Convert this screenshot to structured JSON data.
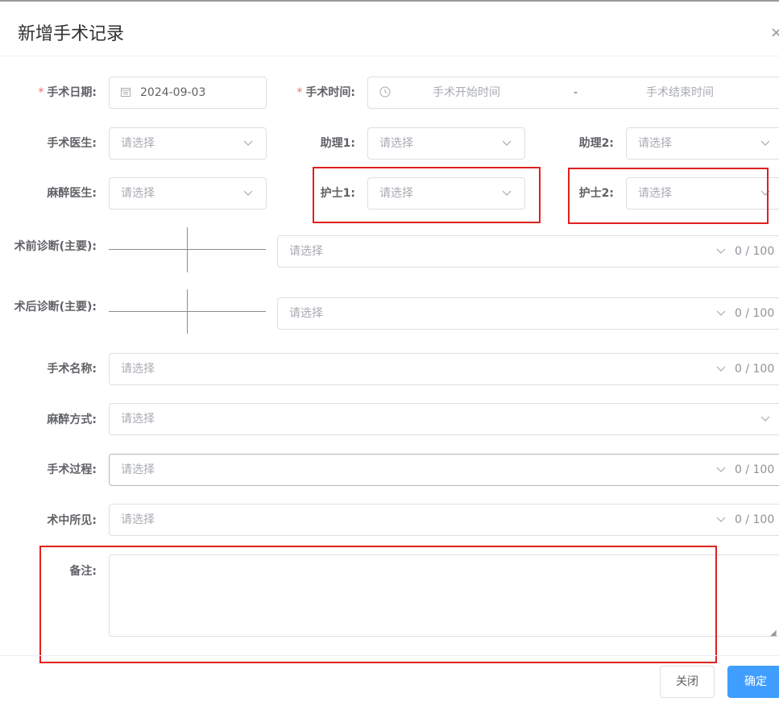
{
  "dialog": {
    "title": "新增手术记录",
    "close_icon": "×"
  },
  "form": {
    "surgery_date": {
      "label": "手术日期:",
      "required_mark": "*",
      "value": "2024-09-03"
    },
    "surgery_time": {
      "label": "手术时间:",
      "required_mark": "*",
      "start_placeholder": "手术开始时间",
      "separator": "-",
      "end_placeholder": "手术结束时间"
    },
    "surgeon": {
      "label": "手术医生:",
      "placeholder": "请选择"
    },
    "assistant1": {
      "label": "助理1:",
      "placeholder": "请选择"
    },
    "assistant2": {
      "label": "助理2:",
      "placeholder": "请选择"
    },
    "anesthetist": {
      "label": "麻醉医生:",
      "placeholder": "请选择"
    },
    "nurse1": {
      "label": "护士1:",
      "placeholder": "请选择"
    },
    "nurse2": {
      "label": "护士2:",
      "placeholder": "请选择"
    },
    "preop_diagnosis": {
      "label": "术前诊断(主要):",
      "placeholder": "请选择",
      "counter": "0 / 100"
    },
    "postop_diagnosis": {
      "label": "术后诊断(主要):",
      "placeholder": "请选择",
      "counter": "0 / 100"
    },
    "surgery_name": {
      "label": "手术名称:",
      "placeholder": "请选择",
      "counter": "0 / 100"
    },
    "anesthesia_method": {
      "label": "麻醉方式:",
      "placeholder": "请选择"
    },
    "surgery_process": {
      "label": "手术过程:",
      "placeholder": "请选择",
      "counter": "0 / 100"
    },
    "intraop_findings": {
      "label": "术中所见:",
      "placeholder": "请选择",
      "counter": "0 / 100"
    },
    "remarks": {
      "label": "备注:",
      "value": ""
    }
  },
  "footer": {
    "close_label": "关闭",
    "confirm_label": "确定"
  },
  "colors": {
    "primary": "#409eff",
    "required": "#f56c6c",
    "highlight_box": "#e02020"
  },
  "icons": {
    "calendar": "calendar-icon",
    "clock": "clock-icon",
    "chevron": "chevron-down-icon",
    "close": "close-icon"
  }
}
